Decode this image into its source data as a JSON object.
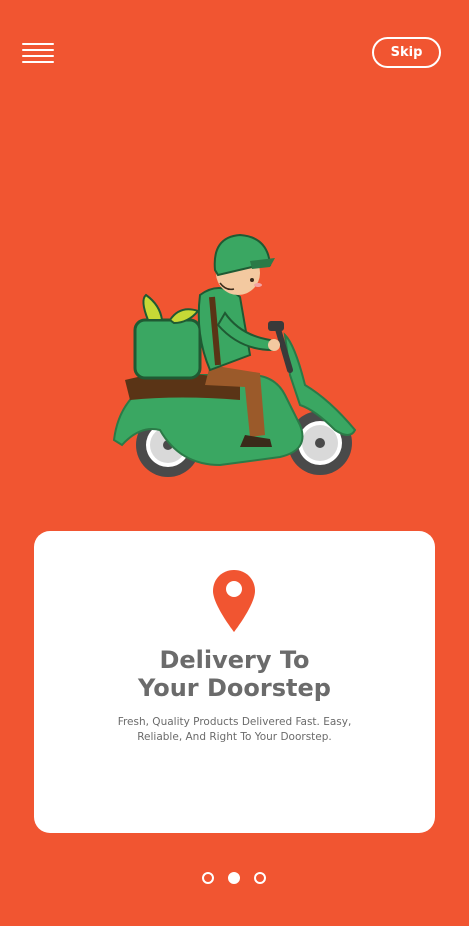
{
  "header": {
    "menu_icon": "hamburger-menu-icon",
    "skip_label": "Skip"
  },
  "hero": {
    "illustration": "delivery-rider-on-green-scooter"
  },
  "card": {
    "icon": "location-pin-icon",
    "title": "Delivery To\nYour Doorstep",
    "description": "Fresh, Quality Products Delivered Fast. Easy, Reliable, And Right To Your Doorstep."
  },
  "pagination": {
    "pages": 3,
    "current": 2
  },
  "colors": {
    "background": "#f15531",
    "card": "#ffffff",
    "text": "#6b6b6b",
    "accent_green": "#3aa762",
    "pin": "#f15531"
  }
}
